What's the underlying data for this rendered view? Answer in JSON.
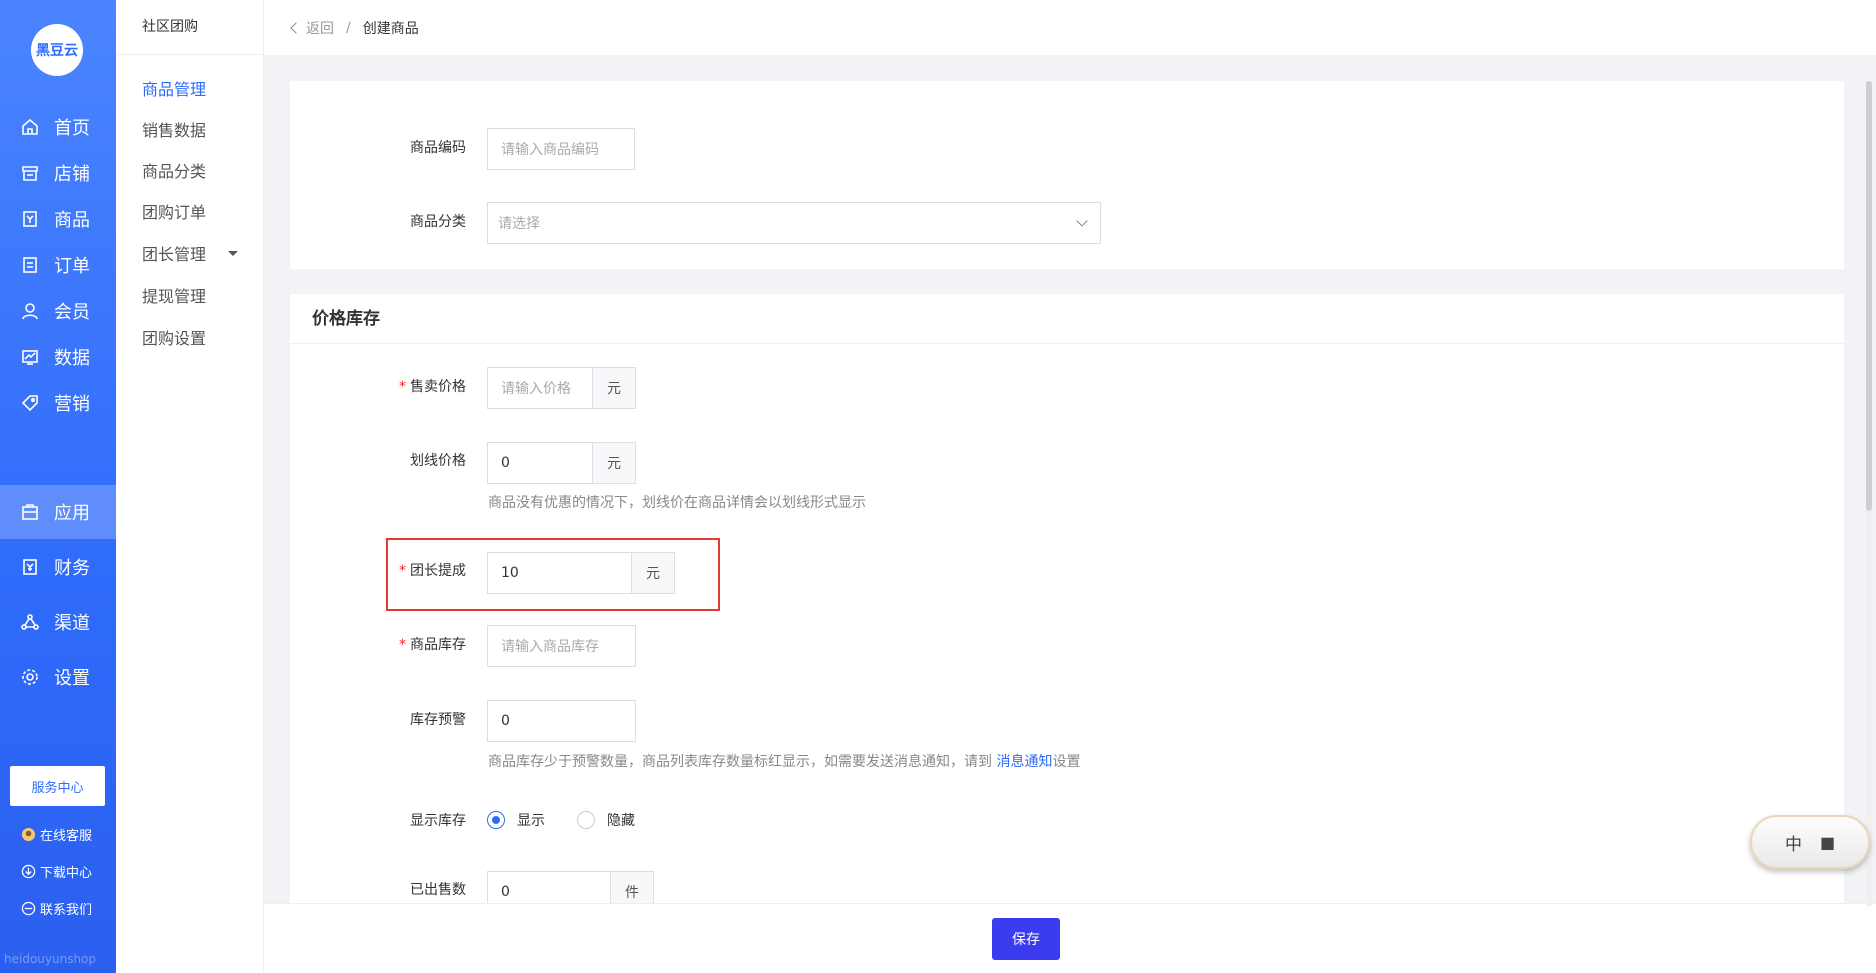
{
  "brand": {
    "logo_text": "黑豆云",
    "watermark": "heidouyunshop"
  },
  "nav": {
    "items": [
      {
        "label": "首页",
        "icon": "home-icon"
      },
      {
        "label": "店铺",
        "icon": "store-icon"
      },
      {
        "label": "商品",
        "icon": "goods-icon"
      },
      {
        "label": "订单",
        "icon": "order-icon"
      },
      {
        "label": "会员",
        "icon": "user-icon"
      },
      {
        "label": "数据",
        "icon": "chart-icon"
      },
      {
        "label": "营销",
        "icon": "tag-icon"
      },
      {
        "label": "应用",
        "icon": "app-icon"
      },
      {
        "label": "财务",
        "icon": "finance-icon"
      },
      {
        "label": "渠道",
        "icon": "channel-icon"
      },
      {
        "label": "设置",
        "icon": "gear-icon"
      }
    ],
    "active": "应用",
    "service_center": "服务中心",
    "footer": [
      {
        "label": "在线客服",
        "icon": "chat-avatar-icon"
      },
      {
        "label": "下载中心",
        "icon": "download-icon"
      },
      {
        "label": "联系我们",
        "icon": "contact-icon"
      }
    ]
  },
  "subnav": {
    "title": "社区团购",
    "items": [
      "商品管理",
      "销售数据",
      "商品分类",
      "团购订单",
      "团长管理",
      "提现管理",
      "团购设置"
    ],
    "active": "商品管理"
  },
  "breadcrumb": {
    "back": "返回",
    "separator": "/",
    "current": "创建商品"
  },
  "basic": {
    "code_label": "商品编码",
    "code_placeholder": "请输入商品编码",
    "category_label": "商品分类",
    "category_placeholder": "请选择"
  },
  "price_section": {
    "title": "价格库存",
    "sale_price": {
      "label": "售卖价格",
      "placeholder": "请输入价格",
      "suffix": "元"
    },
    "strike_price": {
      "label": "划线价格",
      "value": "0",
      "suffix": "元",
      "helper": "商品没有优惠的情况下，划线价在商品详情会以划线形式显示"
    },
    "commission": {
      "label": "团长提成",
      "value": "10",
      "suffix": "元"
    },
    "stock": {
      "label": "商品库存",
      "placeholder": "请输入商品库存"
    },
    "stock_alert": {
      "label": "库存预警",
      "value": "0",
      "helper_prefix": "商品库存少于预警数量，商品列表库存数量标红显示，如需要发送消息通知，请到 ",
      "helper_link": "消息通知",
      "helper_suffix": "设置"
    },
    "show_stock": {
      "label": "显示库存",
      "options": [
        "显示",
        "隐藏"
      ],
      "selected": "显示"
    },
    "sold": {
      "label": "已出售数",
      "value": "0",
      "suffix": "件"
    }
  },
  "actions": {
    "save": "保存"
  },
  "widget": {
    "text": "中"
  },
  "colors": {
    "primary": "#2f6bfa",
    "highlight_border": "#e53935",
    "required": "#f5222d",
    "save_button": "#3b3bf0"
  }
}
